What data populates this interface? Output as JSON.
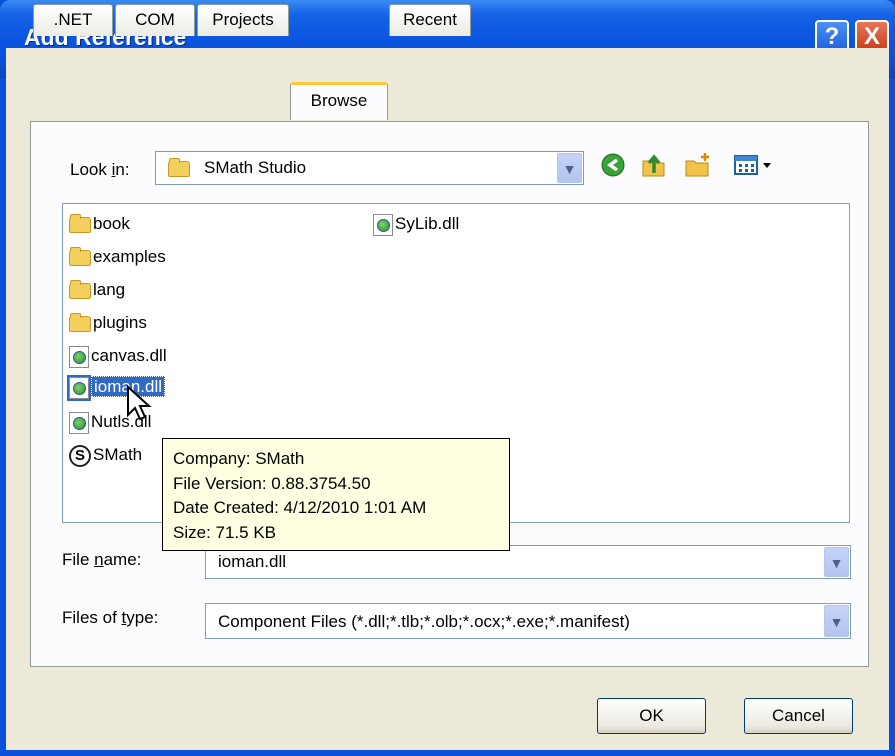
{
  "window": {
    "title": "Add Reference",
    "help_label": "?",
    "close_label": "X"
  },
  "tabs": [
    {
      "label": ".NET"
    },
    {
      "label": "COM"
    },
    {
      "label": "Projects"
    },
    {
      "label": "Browse"
    },
    {
      "label": "Recent"
    }
  ],
  "look_in": {
    "label_pre": "Look ",
    "label_u": "i",
    "label_post": "n:",
    "value": "SMath Studio"
  },
  "toolbar": {
    "back_icon": "back-arrow-icon",
    "up_icon": "up-folder-icon",
    "new_folder_icon": "new-folder-icon",
    "view_menu_icon": "view-menu-icon"
  },
  "files": [
    {
      "name": "book",
      "type": "folder"
    },
    {
      "name": "examples",
      "type": "folder"
    },
    {
      "name": "lang",
      "type": "folder"
    },
    {
      "name": "plugins",
      "type": "folder"
    },
    {
      "name": "canvas.dll",
      "type": "dll"
    },
    {
      "name": "ioman.dll",
      "type": "dll",
      "selected": true
    },
    {
      "name": "Nutls.dll",
      "type": "dll"
    },
    {
      "name": "SMath",
      "type": "smath"
    },
    {
      "name": "SyLib.dll",
      "type": "dll"
    }
  ],
  "tooltip": {
    "company": "Company: SMath",
    "file_version": "File Version: 0.88.3754.50",
    "date_created": "Date Created: 4/12/2010 1:01 AM",
    "size": "Size: 71.5 KB"
  },
  "file_name": {
    "label_pre": "File ",
    "label_u": "n",
    "label_post": "ame:",
    "value": "ioman.dll"
  },
  "file_type": {
    "label_pre": "Files of ",
    "label_u": "t",
    "label_post": "ype:",
    "value": "Component Files (*.dll;*.tlb;*.olb;*.ocx;*.exe;*.manifest)"
  },
  "buttons": {
    "ok": "OK",
    "cancel": "Cancel"
  },
  "colors": {
    "titlebar": "#0a50d8",
    "face": "#ece9d8",
    "selection": "#316ac5",
    "tooltip": "#ffffe1",
    "tab_highlight": "#ffc83c"
  }
}
